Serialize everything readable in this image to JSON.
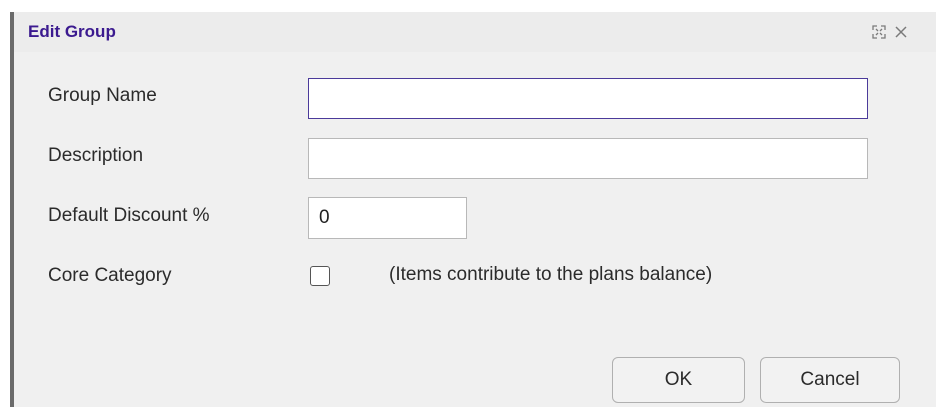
{
  "dialog": {
    "title": "Edit Group",
    "icons": {
      "maximize": "maximize-icon",
      "close": "close-icon"
    }
  },
  "form": {
    "group_name": {
      "label": "Group Name",
      "value": ""
    },
    "description": {
      "label": "Description",
      "value": ""
    },
    "default_discount": {
      "label": "Default Discount %",
      "value": "0"
    },
    "core_category": {
      "label": "Core Category",
      "checked": false,
      "note": "(Items contribute to the plans balance)"
    }
  },
  "buttons": {
    "ok": "OK",
    "cancel": "Cancel"
  },
  "colors": {
    "title": "#3b1a8f",
    "focus_border": "#4b3a9a",
    "dialog_bg": "#f0f0f0"
  }
}
